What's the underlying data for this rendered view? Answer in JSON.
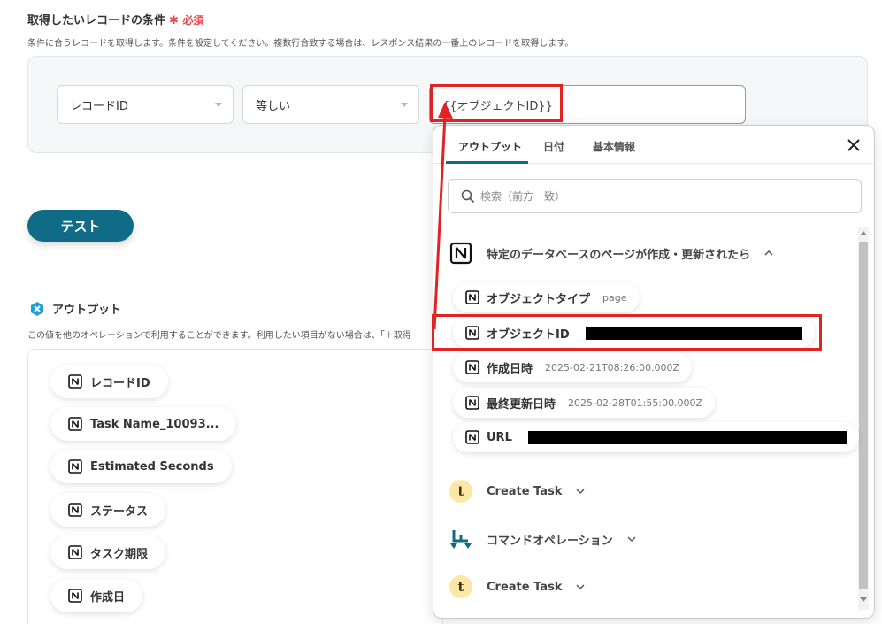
{
  "condition": {
    "title": "取得したいレコードの条件",
    "required_star": "✱",
    "required_label": "必須",
    "description": "条件に合うレコードを取得します。条件を設定してください。複数行合致する場合は、レスポンス結果の一番上のレコードを取得します。",
    "field_select": "レコードID",
    "operator_select": "等しい",
    "value": "{{オブジェクトID}}"
  },
  "test_button": "テスト",
  "output": {
    "title": "アウトプット",
    "description": "この値を他のオペレーションで利用することができます。利用したい項目がない場合は、「＋取得",
    "chips": [
      "レコードID",
      "Task Name_10093...",
      "Estimated Seconds",
      "ステータス",
      "タスク期限",
      "作成日"
    ]
  },
  "popup": {
    "tabs": [
      "アウトプット",
      "日付",
      "基本情報"
    ],
    "search_placeholder": "検索（前方一致）",
    "groups": [
      {
        "label": "特定のデータベースのページが作成・更新されたら",
        "icon": "notion-icon",
        "expanded": true
      },
      {
        "label": "Create Task",
        "icon": "t-app-icon",
        "expanded": false
      },
      {
        "label": "コマンドオペレーション",
        "icon": "command-operation-icon",
        "expanded": false
      },
      {
        "label": "Create Task",
        "icon": "t-app-icon",
        "expanded": false
      }
    ],
    "items": [
      {
        "label": "オブジェクトタイプ",
        "value": "page"
      },
      {
        "label": "オブジェクトID",
        "value": ""
      },
      {
        "label": "作成日時",
        "value": "2025-02-21T08:26:00.000Z"
      },
      {
        "label": "最終更新日時",
        "value": "2025-02-28T01:55:00.000Z"
      },
      {
        "label": "URL",
        "value": ""
      }
    ]
  },
  "colors": {
    "accent": "#0f6b86",
    "highlight": "#e02424",
    "required": "#e5484d"
  }
}
